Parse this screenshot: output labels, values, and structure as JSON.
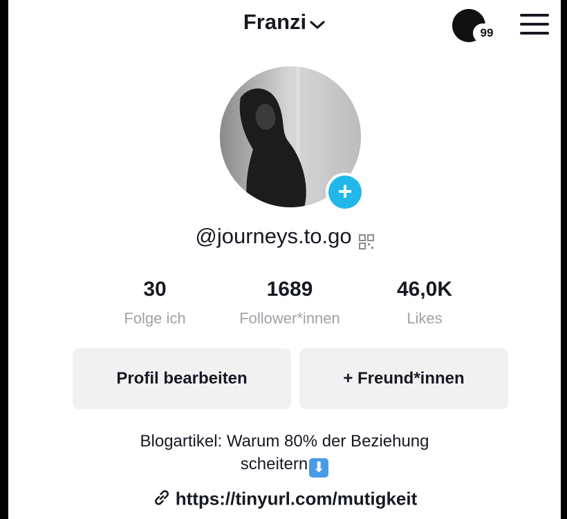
{
  "header": {
    "username": "Franzi",
    "notification_count": "99",
    "icons": {
      "dropdown": "chevron-down-icon",
      "activity": "activity-avatar-icon",
      "menu": "hamburger-menu-icon"
    }
  },
  "profile": {
    "handle": "@journeys.to.go",
    "avatar_icon": "profile-photo",
    "add_icon": "plus-icon",
    "qr_icon": "qr-code-icon",
    "accent": "#21b8e9"
  },
  "stats": [
    {
      "value": "30",
      "label": "Folge ich"
    },
    {
      "value": "1689",
      "label": "Follower*innen"
    },
    {
      "value": "46,0K",
      "label": "Likes"
    }
  ],
  "buttons": {
    "edit_profile": "Profil bearbeiten",
    "add_friends": "+ Freund*innen"
  },
  "bio": {
    "line1": "Blogartikel: Warum 80% der Beziehung",
    "line2": "scheitern",
    "emoji": "⬇"
  },
  "link": {
    "url": "https://tinyurl.com/mutigkeit",
    "icon": "link-icon"
  }
}
